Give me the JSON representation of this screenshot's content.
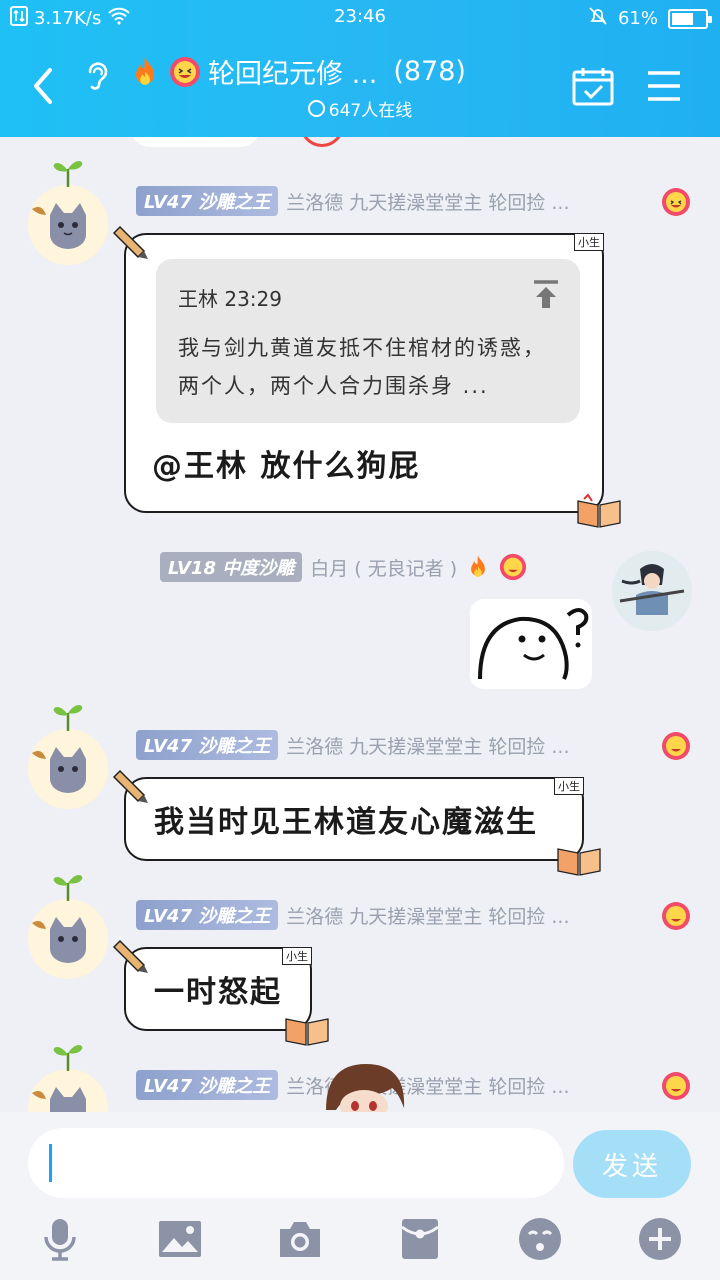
{
  "status_bar": {
    "net_speed": "3.17K/s",
    "time": "23:46",
    "battery": "61%"
  },
  "header": {
    "title": "轮回纪元修 ...",
    "member_count": "(878)",
    "online": "647人在线"
  },
  "messages": [
    {
      "level": "LV47",
      "rank": "沙雕之王",
      "name": "兰洛德 九天搓澡堂堂主 轮回捡 ...",
      "tag": "小生",
      "quote": {
        "author": "王林 23:29",
        "text": "我与剑九黄道友抵不住棺材的诱惑，两个人，两个人合力围杀身 ..."
      },
      "text": "@王林 放什么狗屁"
    },
    {
      "level": "LV18",
      "rank": "中度沙雕",
      "name": "白月 ( 无良记者 )"
    },
    {
      "level": "LV47",
      "rank": "沙雕之王",
      "name": "兰洛德 九天搓澡堂堂主 轮回捡 ...",
      "tag": "小生",
      "text": "我当时见王林道友心魔滋生"
    },
    {
      "level": "LV47",
      "rank": "沙雕之王",
      "name": "兰洛德 九天搓澡堂堂主 轮回捡 ...",
      "tag": "小生",
      "text": "一时怒起"
    },
    {
      "level": "LV47",
      "rank": "沙雕之王",
      "name": "兰洛德 九天搓澡堂堂主 轮回捡 ..."
    }
  ],
  "input": {
    "send_label": "发送"
  },
  "toolbar": [
    "mic-icon",
    "image-icon",
    "camera-icon",
    "red-packet-icon",
    "emoji-icon",
    "plus-icon"
  ],
  "colors": {
    "header": "#1fb8f3",
    "send_button": "#a5def7",
    "level_badge": "#8da1cc"
  }
}
